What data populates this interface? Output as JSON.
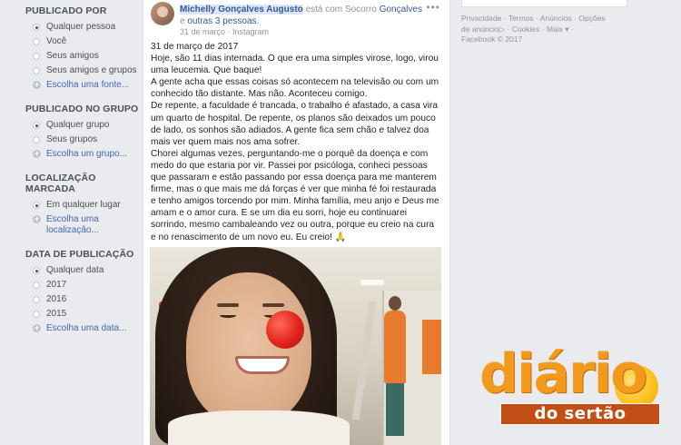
{
  "sidebar": {
    "groups": [
      {
        "title": "PUBLICADO POR",
        "options": [
          {
            "label": "Qualquer pessoa",
            "selected": true
          },
          {
            "label": "Você",
            "selected": false
          },
          {
            "label": "Seus amigos",
            "selected": false
          },
          {
            "label": "Seus amigos e grupos",
            "selected": false
          }
        ],
        "link": "Escolha uma fonte..."
      },
      {
        "title": "PUBLICADO NO GRUPO",
        "options": [
          {
            "label": "Qualquer grupo",
            "selected": true
          },
          {
            "label": "Seus grupos",
            "selected": false
          }
        ],
        "link": "Escolha um grupo..."
      },
      {
        "title": "LOCALIZAÇÃO MARCADA",
        "options": [
          {
            "label": "Em qualquer lugar",
            "selected": true
          }
        ],
        "link": "Escolha uma localização..."
      },
      {
        "title": "DATA DE PUBLICAÇÃO",
        "options": [
          {
            "label": "Qualquer data",
            "selected": true
          },
          {
            "label": "2017",
            "selected": false
          },
          {
            "label": "2016",
            "selected": false
          },
          {
            "label": "2015",
            "selected": false
          }
        ],
        "link": "Escolha uma data..."
      }
    ]
  },
  "post": {
    "author": "Michelly Gonçalves Augusto",
    "at_text": "está com Socorro",
    "tagged": "Gonçalves",
    "and_text": "e",
    "others": "outras 3 pessoas.",
    "date": "31 de março",
    "source": "Instagram",
    "more_icon": "ellipsis-icon",
    "paragraphs": [
      "31 de março de 2017",
      "Hoje, são 11 dias internada. O que era uma simples virose, logo, virou uma leucemia. Que baque!",
      "A gente acha que essas coisas só acontecem na televisão ou com um conhecido tão distante. Mas não. Aconteceu comigo.",
      "De repente, a faculdade é trancada, o trabalho é afastado, a casa vira um quarto de hospital. De repente, os planos são deixados um pouco de lado, os sonhos são adiados. A gente fica sem chão e talvez doa mais ver quem mais nos ama sofrer.",
      "Chorei algumas vezes, perguntando-me o porquê da doença e com medo do que estaria por vir. Passei por psicóloga, conheci pessoas que passaram e estão passando por essa doença para me manterem firme, mas o que mais me dá forças é ver que minha fé foi restaurada e tenho amigos torcendo por mim. Minha família, meu anjo e Deus me amam e o amor cura. E se um dia eu sorri, hoje eu continuarei sorrindo, mesmo cambaleando vez ou outra, porque eu creio na cura e no renascimento de um novo eu. Eu creio! 🙏"
    ]
  },
  "footer": {
    "links": [
      "Privacidade",
      "Termos",
      "Anúncios",
      "Opções de anúncio",
      "Cookies",
      "Mais"
    ],
    "copyright": "Facebook © 2017"
  },
  "watermark": {
    "word": "diário",
    "band": "do sertão"
  }
}
